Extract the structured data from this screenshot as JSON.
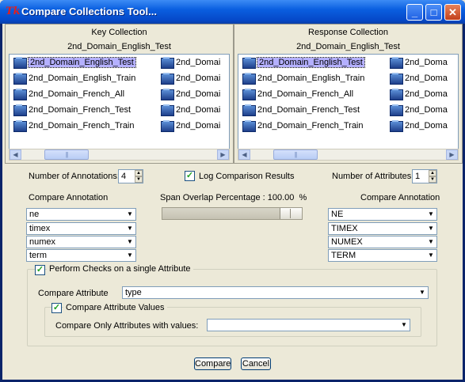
{
  "window": {
    "title": "Compare Collections Tool...",
    "app_icon": "tk-logo-icon"
  },
  "titlebar_buttons": {
    "minimize": "_",
    "maximize": "□",
    "close": "✕"
  },
  "key_collection": {
    "header": "Key Collection",
    "name": "2nd_Domain_English_Test",
    "items": [
      "2nd_Domain_English_Test",
      "2nd_Domain_English_Train",
      "2nd_Domain_French_All",
      "2nd_Domain_French_Test",
      "2nd_Domain_French_Train"
    ],
    "items_col2": [
      "2nd_Domai",
      "2nd_Domai",
      "2nd_Domai",
      "2nd_Domai",
      "2nd_Domai"
    ],
    "selected_index": 0
  },
  "response_collection": {
    "header": "Response Collection",
    "name": "2nd_Domain_English_Test",
    "items": [
      "2nd_Domain_English_Test",
      "2nd_Domain_English_Train",
      "2nd_Domain_French_All",
      "2nd_Domain_French_Test",
      "2nd_Domain_French_Train"
    ],
    "items_col2": [
      "2nd_Doma",
      "2nd_Doma",
      "2nd_Doma",
      "2nd_Doma",
      "2nd_Doma"
    ],
    "selected_index": 0
  },
  "scroll": {
    "left_arrow": "◀",
    "right_arrow": "▶",
    "grip": "|||"
  },
  "annotations": {
    "label": "Number of Annotations:",
    "value": "4"
  },
  "log": {
    "label": "Log Comparison Results",
    "checked": true
  },
  "attributes": {
    "label": "Number of Attributes:",
    "value": "1"
  },
  "compare_annotation_left": {
    "label": "Compare Annotation",
    "values": [
      "ne",
      "timex",
      "numex",
      "term"
    ]
  },
  "compare_annotation_right": {
    "label": "Compare Annotation",
    "values": [
      "NE",
      "TIMEX",
      "NUMEX",
      "TERM"
    ]
  },
  "span_overlap": {
    "label": "Span Overlap Percentage :",
    "value": "100.00",
    "unit": "%",
    "level": 1.0
  },
  "perform_checks": {
    "label": "Perform Checks on a single Attribute",
    "checked": true
  },
  "compare_attribute": {
    "label": "Compare Attribute",
    "value": "type"
  },
  "compare_values": {
    "label": "Compare Attribute Values",
    "checked": true
  },
  "compare_only": {
    "label": "Compare Only Attributes with values:",
    "value": ""
  },
  "buttons": {
    "compare": "Compare",
    "cancel": "Cancel"
  },
  "glyphs": {
    "check": "✓",
    "dropdown": "▼",
    "up": "▲",
    "down": "▼"
  },
  "colors": {
    "titlebar": "#0a5fe0",
    "selection": "#b4b0ff",
    "dialog_bg": "#ece9d8"
  }
}
